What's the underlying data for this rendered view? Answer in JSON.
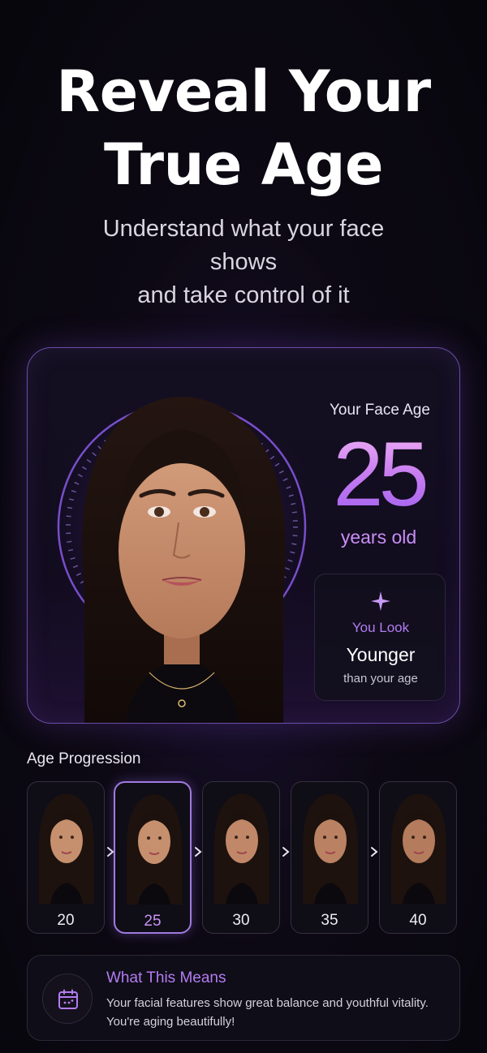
{
  "hero": {
    "title_line1": "Reveal Your",
    "title_line2": "True Age",
    "subtitle_line1": "Understand what your face",
    "subtitle_line2": "shows",
    "subtitle_line3": "and take control of it"
  },
  "result": {
    "label": "Your Face Age",
    "age": "25",
    "unit": "years old",
    "verdict_icon": "sparkle-icon",
    "verdict_prefix": "You Look",
    "verdict": "Younger",
    "verdict_suffix": "than your age"
  },
  "progression": {
    "label": "Age Progression",
    "selected_age": "25",
    "ages": [
      "20",
      "25",
      "30",
      "35",
      "40"
    ]
  },
  "meaning": {
    "icon": "calendar-icon",
    "title": "What This Means",
    "body": "Your facial features show great balance and youthful vitality. You're aging beautifully!"
  },
  "colors": {
    "accent": "#b37cf2",
    "gradient_top": "#f6b8f4",
    "gradient_bottom": "#9a5cf0",
    "background": "#0b0810"
  }
}
